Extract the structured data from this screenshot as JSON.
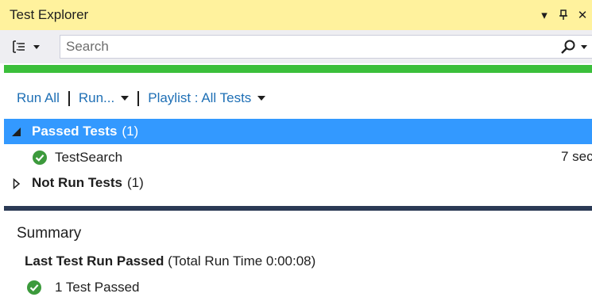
{
  "window": {
    "title": "Test Explorer",
    "controls": [
      "▾",
      "ⵊ",
      "✕"
    ]
  },
  "toolbar": {
    "group_icon": "group-by-icon",
    "search": {
      "placeholder": "Search",
      "value": ""
    }
  },
  "progress": {
    "value": 1.0,
    "color": "#3bbf3b"
  },
  "commands": {
    "run_all": "Run All",
    "run": "Run...",
    "playlist": "Playlist : All Tests"
  },
  "groups": {
    "passed": {
      "name": "Passed Tests",
      "count": "(1)",
      "expanded": true,
      "selected": true
    },
    "not_run": {
      "name": "Not Run Tests",
      "count": "(1)",
      "expanded": false
    }
  },
  "tests": [
    {
      "name": "TestSearch",
      "duration": "7 sec",
      "status": "passed"
    }
  ],
  "summary": {
    "title": "Summary",
    "run_status": "Last Test Run Passed",
    "run_time": "(Total Run Time 0:00:08)",
    "passed_text": "1 Test Passed"
  },
  "colors": {
    "title_bar": "#fff29d",
    "selection": "#3399ff",
    "link": "#1e6fb5",
    "pass": "#3c9a3c",
    "splitter": "#2b3a55"
  }
}
